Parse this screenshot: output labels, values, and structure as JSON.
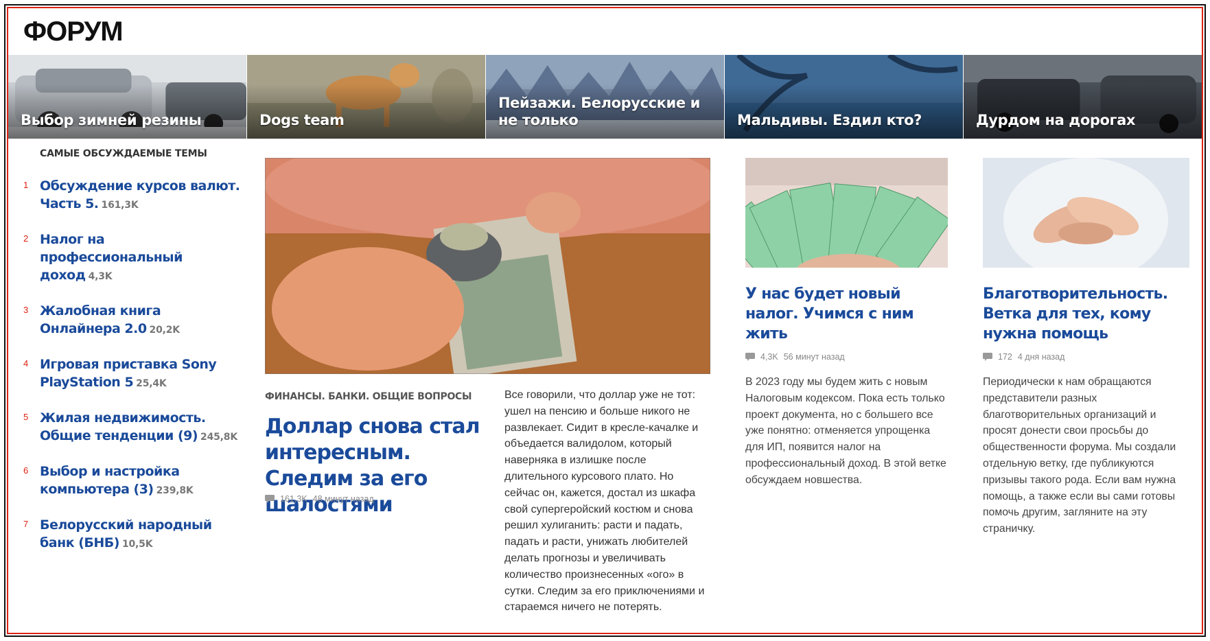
{
  "header": {
    "logo": "ФОРУМ"
  },
  "banners": [
    {
      "label": "Выбор зимней резины"
    },
    {
      "label": "Dogs team"
    },
    {
      "label": "Пейзажи. Белорусские и не только"
    },
    {
      "label": "Мальдивы. Ездил кто?"
    },
    {
      "label": "Дурдом на дорогах"
    }
  ],
  "sidebar": {
    "title": "САМЫЕ ОБСУЖДАЕМЫЕ ТЕМЫ",
    "topics": [
      {
        "num": "1",
        "title": "Обсуждение курсов валют. Часть 5.",
        "count": "161,3K"
      },
      {
        "num": "2",
        "title": "Налог на профессиональный доход",
        "count": "4,3K"
      },
      {
        "num": "3",
        "title": "Жалобная книга Онлайнера 2.0",
        "count": "20,2K"
      },
      {
        "num": "4",
        "title": "Игровая приставка Sony PlayStation 5",
        "count": "25,4K"
      },
      {
        "num": "5",
        "title": "Жилая недвижимость. Общие тенденции (9)",
        "count": "245,8K"
      },
      {
        "num": "6",
        "title": "Выбор и настройка компьютера (3)",
        "count": "239,8K"
      },
      {
        "num": "7",
        "title": "Белорусский народный банк (БНБ)",
        "count": "10,5K"
      }
    ]
  },
  "feature": {
    "category": "ФИНАНСЫ. БАНКИ. ОБЩИЕ ВОПРОСЫ",
    "title": "Доллар снова стал интересным. Следим за его шалостями",
    "count": "161,3K",
    "time": "48 минут назад",
    "text": "Все говорили, что доллар уже не тот: ушел на пенсию и больше никого не развлекает. Сидит в кресле-качалке и объедается валидолом, который наверняка в излишке после длительного курсового плато. Но сейчас он, кажется, достал из шкафа свой супергеройский костюм и снова решил хулиганить: расти и падать, падать и расти, унижать любителей делать прогнозы и увеличивать количество произнесенных «ого» в сутки. Следим за его приключениями и стараемся ничего не потерять."
  },
  "cards": [
    {
      "title": "У нас будет новый налог. Учимся с ним жить",
      "count": "4,3K",
      "time": "56 минут назад",
      "text": "В 2023 году мы будем жить с новым Налоговым кодексом. Пока есть только проект документа, но с большего все уже понятно: отменяется упрощенка для ИП, появится налог на профессиональный доход. В этой ветке обсуждаем новшества."
    },
    {
      "title": "Благотворительность. Ветка для тех, кому нужна помощь",
      "count": "172",
      "time": "4 дня назад",
      "text": "Периодически к нам обращаются представители разных благотворительных организаций и просят донести свои просьбы до общественности форума. Мы создали отдельную ветку, где публикуются призывы такого рода. Если вам нужна помощь, а также если вы сами готовы помочь другим, загляните на эту страничку."
    }
  ],
  "colors": {
    "link": "#1a4a9a",
    "accent_red": "#d21f1f",
    "muted": "#888888"
  }
}
